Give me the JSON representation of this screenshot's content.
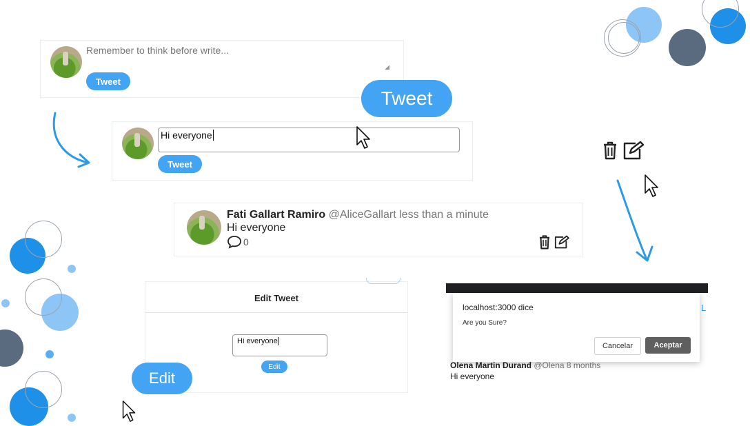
{
  "composer1": {
    "placeholder": "Remember to think before write...",
    "tweet_label": "Tweet"
  },
  "big_tweet_label": "Tweet",
  "composer2": {
    "input_value": "Hi everyone",
    "tweet_label": "Tweet"
  },
  "tweet": {
    "author": "Fati Gallart Ramiro",
    "handle": "@AliceGallart",
    "time": "less than a minute",
    "text": "Hi everyone",
    "comment_count": "0"
  },
  "edit_modal": {
    "title": "Edit Tweet",
    "input_value": "Hi everyone",
    "edit_label": "Edit"
  },
  "big_edit_label": "Edit",
  "confirm_dialog": {
    "title": "localhost:3000 dice",
    "message": "Are you Sure?",
    "cancel_label": "Cancelar",
    "accept_label": "Aceptar"
  },
  "background_tweet": {
    "author": "Olena Martin Durand",
    "handle": "@Olena",
    "time": "8 months",
    "text": "Hi everyone",
    "edge_label": "L"
  },
  "colors": {
    "accent": "#42a4f2",
    "dark": "#5a6b80",
    "light_blue": "#8ec5f7"
  },
  "icons": [
    "trash-icon",
    "edit-icon",
    "comment-icon",
    "cursor-icon",
    "arrow-icon"
  ]
}
